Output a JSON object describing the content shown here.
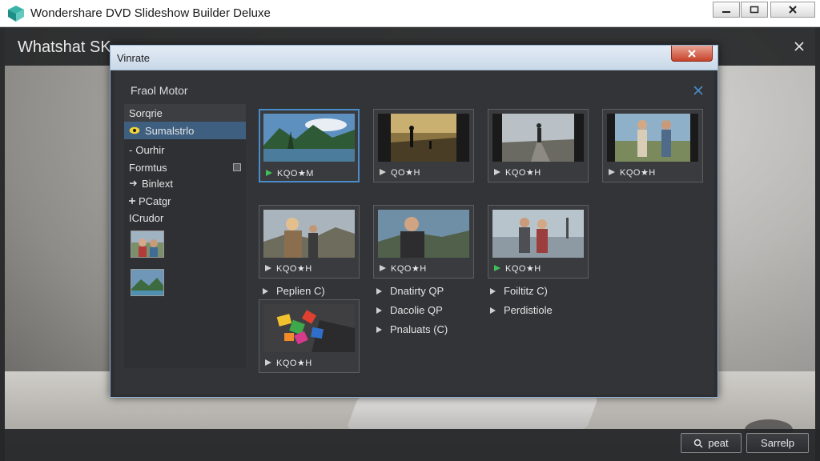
{
  "window": {
    "title": "Wondershare DVD Slideshow Builder Deluxe",
    "brand_color": "#2aa7a0"
  },
  "app": {
    "header_title": "Whatshat SK..."
  },
  "dialog": {
    "title": "Vinrate",
    "panel_title": "Fraol Motor",
    "accent": "#4a8cc8"
  },
  "sidebar": {
    "items": [
      {
        "label": "Sorqrie",
        "kind": "header"
      },
      {
        "label": "Sumalstrlo",
        "kind": "selected",
        "icon": "slideshow-icon"
      },
      {
        "label": "Ourhir",
        "kind": "normal",
        "prefix": "-"
      },
      {
        "label": "Formtus",
        "kind": "normal"
      },
      {
        "label": "Binlext",
        "kind": "normal",
        "icon": "arrow-icon"
      },
      {
        "label": "PCatgr",
        "kind": "normal",
        "icon": "plus-icon"
      },
      {
        "label": "ICrudor",
        "kind": "normal"
      }
    ],
    "thumbnails": [
      "people-photo-thumbnail",
      "landscape-photo-thumbnail"
    ]
  },
  "grid": {
    "thumbnails": [
      {
        "id": "mountain-lake",
        "label": "KQO★M",
        "stars": "★",
        "active": true
      },
      {
        "id": "sunset-figure",
        "label": "QO★H",
        "stars": "★",
        "active": false
      },
      {
        "id": "road-walker",
        "label": "KQO★H",
        "stars": "★",
        "active": false
      },
      {
        "id": "couple-walking",
        "label": "KQO★H",
        "stars": "★",
        "active": false
      },
      {
        "id": "woman-portrait",
        "label": "KQO★H",
        "stars": "★",
        "active": false
      },
      {
        "id": "man-portrait",
        "label": "KQO★H",
        "stars": "★",
        "active": false
      },
      {
        "id": "couple-dock",
        "label": "KQO★H",
        "stars": "★",
        "active": false
      },
      {
        "id": "colorful-shapes",
        "label": "KQO★H",
        "stars": "★",
        "active": false
      }
    ],
    "list_items": [
      {
        "label": "Peplien C)"
      },
      {
        "label": "Dnatirty QP"
      },
      {
        "label": "Dacolie QP"
      },
      {
        "label": "Pnaluats (C)"
      },
      {
        "label": "Foiltitz C)"
      },
      {
        "label": "Perdistiole"
      }
    ]
  },
  "footer": {
    "preview_label": "peat",
    "sample_label": "Sarrelp"
  }
}
